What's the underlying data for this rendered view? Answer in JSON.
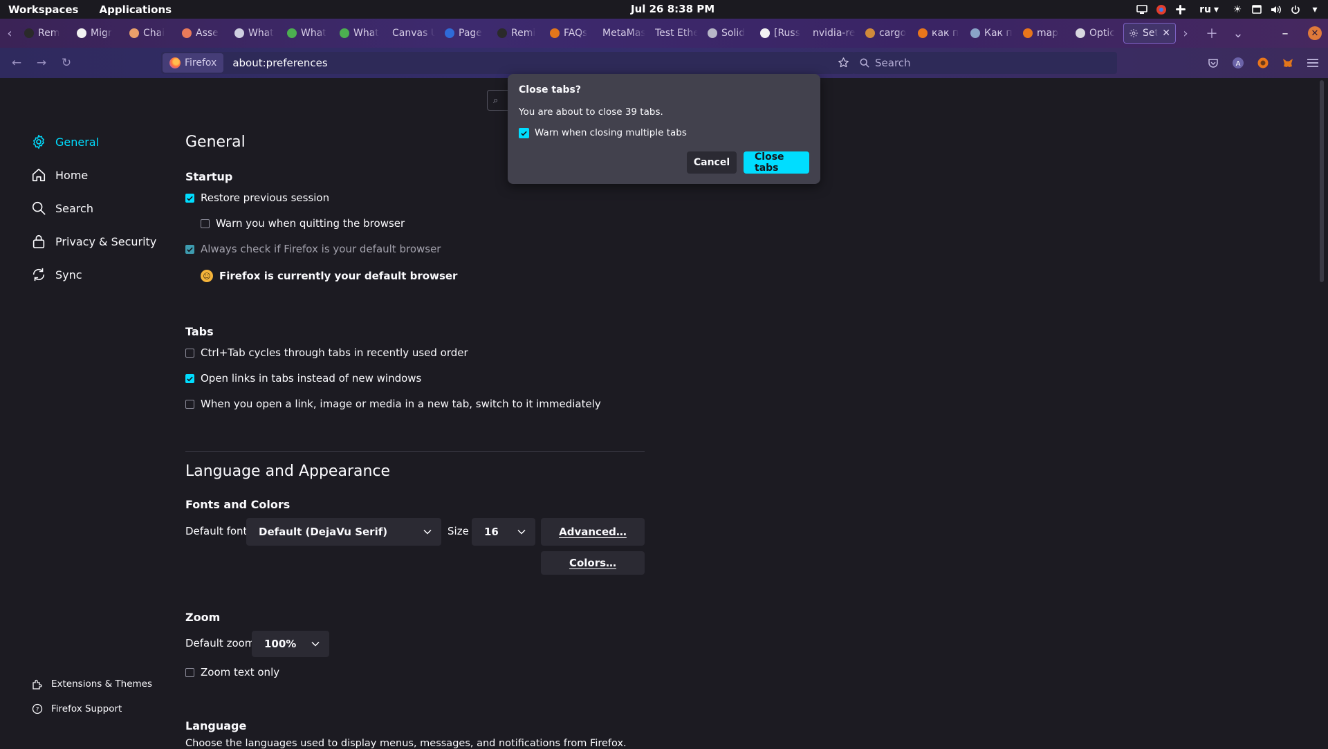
{
  "topbar": {
    "workspaces": "Workspaces",
    "applications": "Applications",
    "clock": "Jul 26  8:38 PM",
    "lang": "ru"
  },
  "tabs": [
    {
      "title": "Rem",
      "color": "#2a2a2a"
    },
    {
      "title": "Migr",
      "color": "#f2f2f2"
    },
    {
      "title": "Chai",
      "color": "#e9a06a"
    },
    {
      "title": "Asse",
      "color": "#e97a5a"
    },
    {
      "title": "What",
      "color": "#cfcfe0"
    },
    {
      "title": "What",
      "color": "#4caf50"
    },
    {
      "title": "What",
      "color": "#4caf50"
    },
    {
      "title": "Canvas U",
      "color": ""
    },
    {
      "title": "Page",
      "color": "#2f6bd8"
    },
    {
      "title": "Remi",
      "color": "#2a2a2a"
    },
    {
      "title": "FAQs",
      "color": "#e2761b"
    },
    {
      "title": "MetaMas",
      "color": ""
    },
    {
      "title": "Test Ethe",
      "color": ""
    },
    {
      "title": "Solid",
      "color": "#b8b8c8"
    },
    {
      "title": "[Russ",
      "color": "#f2f2f2"
    },
    {
      "title": "nvidia-re",
      "color": ""
    },
    {
      "title": "cargo",
      "color": "#d08a3a"
    },
    {
      "title": "как п",
      "color": "#e9761b"
    },
    {
      "title": "Как п",
      "color": "#8aa4c8"
    },
    {
      "title": "map",
      "color": "#e9761b"
    },
    {
      "title": "Optic",
      "color": "#d8d8e0"
    },
    {
      "title": "Set",
      "color": ""
    }
  ],
  "navbar": {
    "identity_label": "Firefox",
    "url": "about:preferences",
    "search_placeholder": "Search"
  },
  "sidebar": {
    "items": [
      {
        "label": "General",
        "icon": "gear-icon"
      },
      {
        "label": "Home",
        "icon": "home-icon"
      },
      {
        "label": "Search",
        "icon": "search-icon"
      },
      {
        "label": "Privacy & Security",
        "icon": "lock-icon"
      },
      {
        "label": "Sync",
        "icon": "sync-icon"
      }
    ],
    "footer": [
      {
        "label": "Extensions & Themes",
        "icon": "puzzle-icon"
      },
      {
        "label": "Firefox Support",
        "icon": "help-icon"
      }
    ]
  },
  "prefs": {
    "title": "General",
    "startup": {
      "heading": "Startup",
      "restore": {
        "label": "Restore previous session",
        "checked": true
      },
      "warn_quit": {
        "label": "Warn you when quitting the browser",
        "checked": false
      },
      "default_check": {
        "label": "Always check if Firefox is your default browser",
        "checked": true
      },
      "default_status": "Firefox is currently your default browser"
    },
    "tabs": {
      "heading": "Tabs",
      "ctrl_tab": {
        "label": "Ctrl+Tab cycles through tabs in recently used order",
        "checked": false
      },
      "open_links": {
        "label": "Open links in tabs instead of new windows",
        "checked": true
      },
      "switch_new": {
        "label": "When you open a link, image or media in a new tab, switch to it immediately",
        "checked": false
      }
    },
    "appearance": {
      "heading": "Language and Appearance",
      "fonts_heading": "Fonts and Colors",
      "default_font_label": "Default font",
      "default_font_value": "Default (DejaVu Serif)",
      "size_label": "Size",
      "size_value": "16",
      "advanced_button": "Advanced…",
      "colors_button": "Colors…"
    },
    "zoom": {
      "heading": "Zoom",
      "default_zoom_label": "Default zoom",
      "default_zoom_value": "100%",
      "zoom_text_only": {
        "label": "Zoom text only",
        "checked": false
      }
    },
    "language": {
      "heading": "Language",
      "description": "Choose the languages used to display menus, messages, and notifications from Firefox."
    }
  },
  "dialog": {
    "title": "Close tabs?",
    "message": "You are about to close 39 tabs.",
    "warn_label": "Warn when closing multiple tabs",
    "warn_checked": true,
    "cancel": "Cancel",
    "confirm": "Close tabs"
  },
  "colors": {
    "accent": "#00ddff",
    "background": "#1c1b22",
    "dialog_bg": "#42414d"
  }
}
